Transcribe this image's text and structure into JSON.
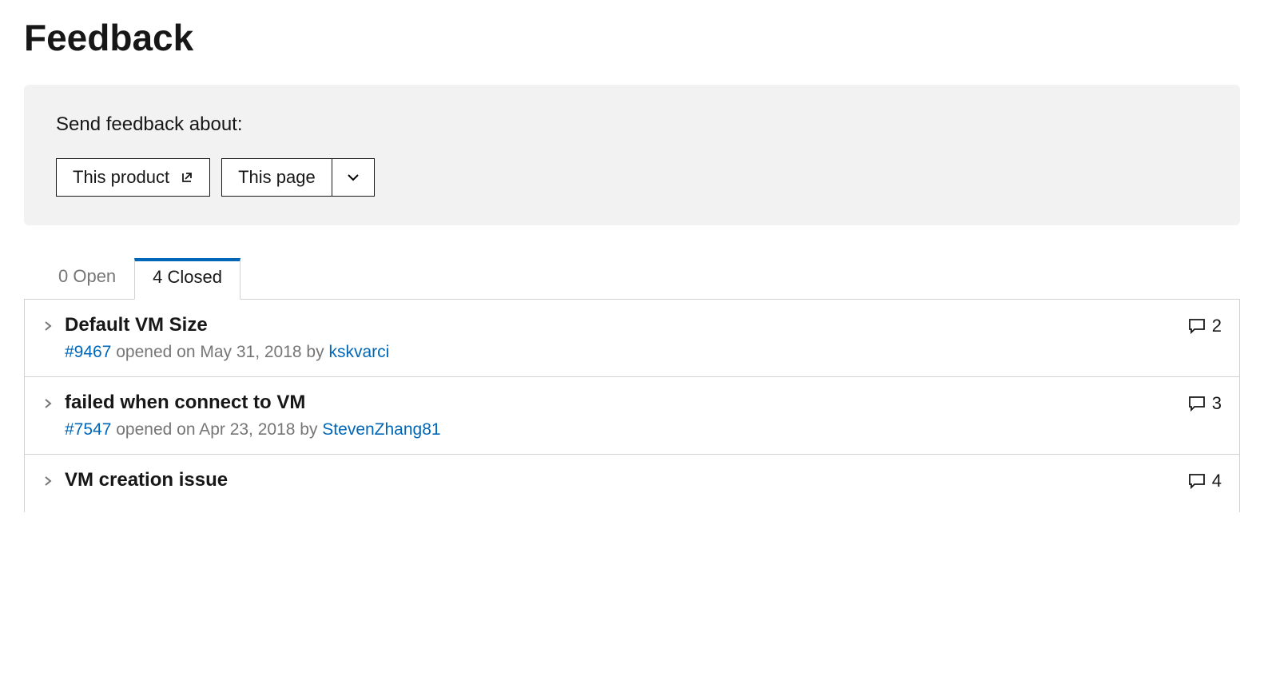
{
  "page": {
    "title": "Feedback"
  },
  "feedback_box": {
    "prompt": "Send feedback about:",
    "product_button": "This product",
    "page_button": "This page"
  },
  "tabs": {
    "open": "0 Open",
    "closed": "4 Closed"
  },
  "issues": [
    {
      "title": "Default VM Size",
      "id": "#9467",
      "meta": " opened on May 31, 2018 by ",
      "author": "kskvarci",
      "comments": "2"
    },
    {
      "title": "failed when connect to VM",
      "id": "#7547",
      "meta": " opened on Apr 23, 2018 by ",
      "author": "StevenZhang81",
      "comments": "3"
    },
    {
      "title": "VM creation issue",
      "id": "",
      "meta": "",
      "author": "",
      "comments": "4"
    }
  ]
}
